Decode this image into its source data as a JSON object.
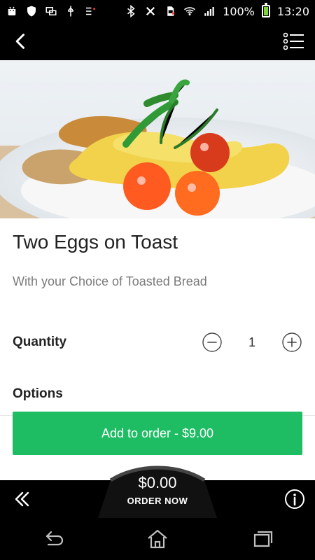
{
  "status_bar": {
    "battery_text": "100%",
    "time": "13:20",
    "icons": [
      "android-debug-icon",
      "shield-icon",
      "screen-mirroring-icon",
      "usb-icon",
      "sync-icon",
      "bluetooth-icon",
      "sim-off-icon",
      "sd-card-icon",
      "wifi-icon",
      "signal-icon",
      "battery-icon"
    ]
  },
  "nav": {
    "back_icon": "back-chevron-icon",
    "menu_icon": "list-menu-icon"
  },
  "item": {
    "title": "Two Eggs on Toast",
    "subtitle": "With your Choice of Toasted Bread",
    "quantity_label": "Quantity",
    "quantity_value": "1",
    "options_label": "Options"
  },
  "cta": {
    "label": "Add to order - $9.00"
  },
  "order_bar": {
    "amount": "$0.00",
    "label": "ORDER NOW",
    "left_icon": "double-left-chevron-icon",
    "right_icon": "info-icon"
  },
  "system_nav": {
    "back_icon": "system-back-icon",
    "home_icon": "home-icon",
    "recents_icon": "recent-apps-icon"
  }
}
